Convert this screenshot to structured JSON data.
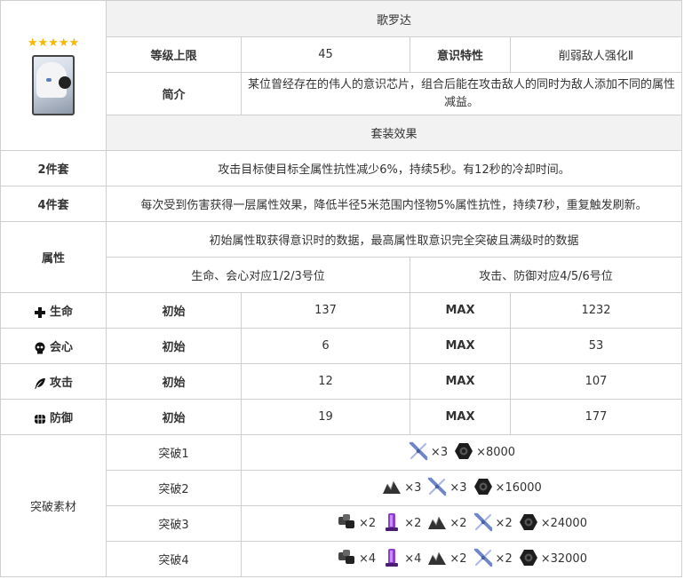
{
  "rarity": "★★★★★",
  "name": "歌罗达",
  "level_cap": {
    "label": "等级上限",
    "value": "45"
  },
  "trait": {
    "label": "意识特性",
    "value": "削弱敌人强化Ⅱ"
  },
  "intro": {
    "label": "简介",
    "value": "某位曾经存在的伟人的意识芯片，组合后能在攻击敌人的同时为敌人添加不同的属性减益。"
  },
  "set_header": "套装效果",
  "set2": {
    "label": "2件套",
    "value": "攻击目标使目标全属性抗性减少6%，持续5秒。有12秒的冷却时间。"
  },
  "set4": {
    "label": "4件套",
    "value": "每次受到伤害获得一层属性效果，降低半径5米范围内怪物5%属性抗性，持续7秒，重复触发刷新。"
  },
  "attributes": {
    "label": "属性",
    "hint": "初始属性取获得意识时的数据，最高属性取意识完全突破且满级时的数据",
    "col_left": "生命、会心对应1/2/3号位",
    "col_right": "攻击、防御对应4/5/6号位",
    "init_label": "初始",
    "max_label": "MAX",
    "rows": [
      {
        "name": "生命",
        "icon": "cross-icon",
        "init": "137",
        "max": "1232"
      },
      {
        "name": "会心",
        "icon": "skull-icon",
        "init": "6",
        "max": "53"
      },
      {
        "name": "攻击",
        "icon": "feather-icon",
        "init": "12",
        "max": "107"
      },
      {
        "name": "防御",
        "icon": "shield-icon",
        "init": "19",
        "max": "177"
      }
    ]
  },
  "breakthrough": {
    "label": "突破素材",
    "rows": [
      {
        "name": "突破1",
        "items": [
          {
            "icon": "blade-material-icon",
            "qty": "×3"
          },
          {
            "icon": "gear-coin-icon",
            "qty": "×8000"
          }
        ]
      },
      {
        "name": "突破2",
        "items": [
          {
            "icon": "ore-material-icon",
            "qty": "×3"
          },
          {
            "icon": "blade-material-icon",
            "qty": "×3"
          },
          {
            "icon": "gear-coin-icon",
            "qty": "×16000"
          }
        ]
      },
      {
        "name": "突破3",
        "items": [
          {
            "icon": "alloy-material-icon",
            "qty": "×2"
          },
          {
            "icon": "purple-tube-icon",
            "qty": "×2"
          },
          {
            "icon": "ore-material-icon",
            "qty": "×2"
          },
          {
            "icon": "blade-material-icon",
            "qty": "×2"
          },
          {
            "icon": "gear-coin-icon",
            "qty": "×24000"
          }
        ]
      },
      {
        "name": "突破4",
        "items": [
          {
            "icon": "alloy-material-icon",
            "qty": "×4"
          },
          {
            "icon": "purple-tube-icon",
            "qty": "×4"
          },
          {
            "icon": "ore-material-icon",
            "qty": "×2"
          },
          {
            "icon": "blade-material-icon",
            "qty": "×2"
          },
          {
            "icon": "gear-coin-icon",
            "qty": "×32000"
          }
        ]
      }
    ]
  }
}
